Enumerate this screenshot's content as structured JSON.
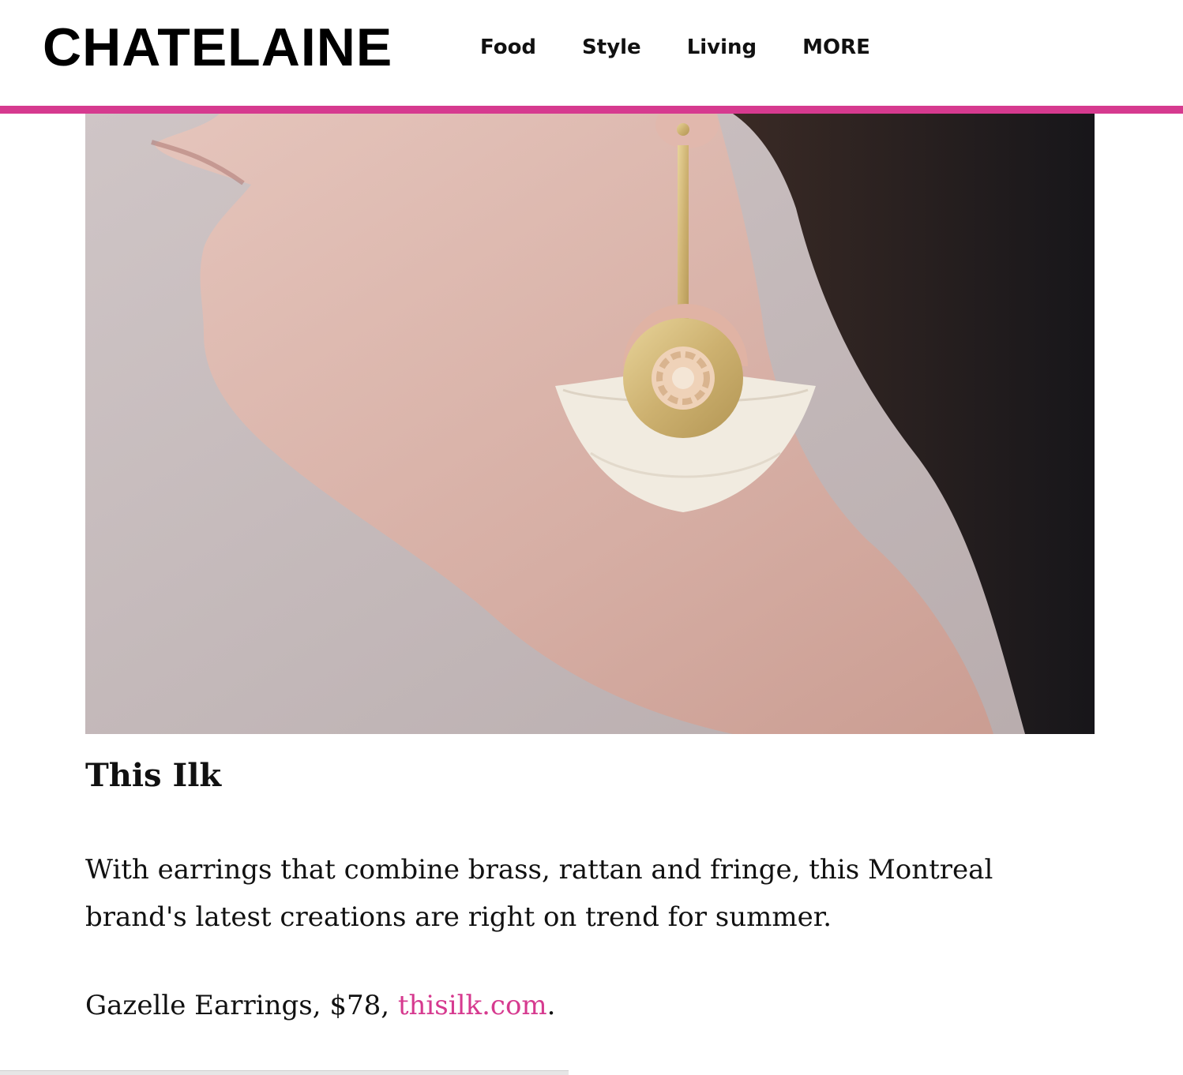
{
  "header": {
    "logo": "CHATELAINE",
    "nav": [
      "Food",
      "Style",
      "Living",
      "MORE"
    ],
    "accent_color": "#d63a8f"
  },
  "hero": {
    "subject": "profile-with-fringe-earring"
  },
  "article": {
    "title": "This Ilk",
    "description": "With earrings that combine brass, rattan and fringe, this Montreal brand's latest creations are right on trend for summer.",
    "product_prefix": "Gazelle Earrings, $78, ",
    "link_text": "thisilk.com",
    "product_suffix": "."
  }
}
